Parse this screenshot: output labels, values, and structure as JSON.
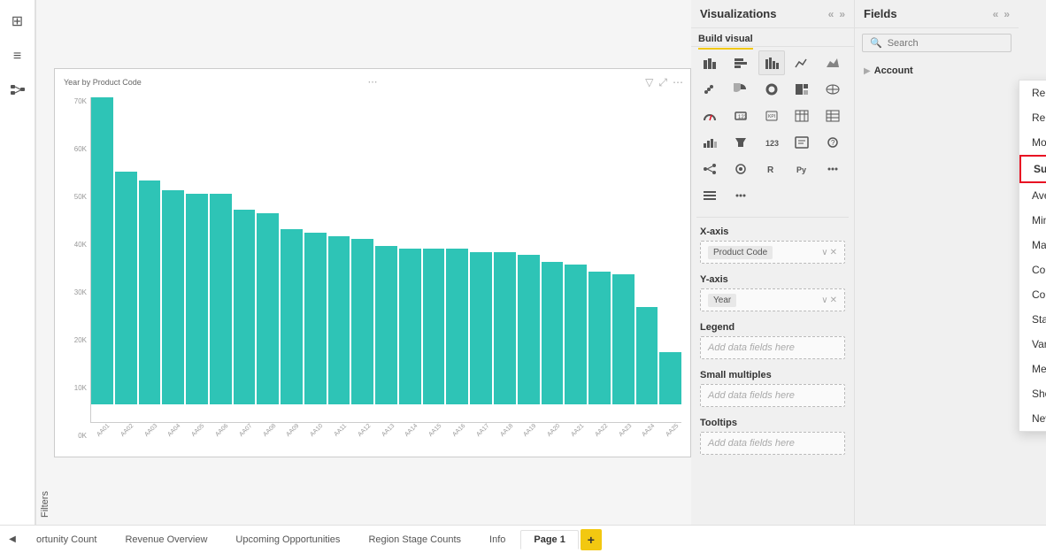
{
  "leftSidebar": {
    "icons": [
      "⊞",
      "≡",
      "📋"
    ]
  },
  "filters": {
    "label": "Filters"
  },
  "chart": {
    "title": "Year by Product Code",
    "yLabels": [
      "70K",
      "60K",
      "50K",
      "40K",
      "30K",
      "20K",
      "10K",
      "0K"
    ],
    "bars": [
      95,
      72,
      69,
      66,
      65,
      65,
      60,
      59,
      54,
      53,
      52,
      51,
      49,
      48,
      48,
      48,
      47,
      47,
      46,
      44,
      43,
      41,
      40,
      30,
      16
    ],
    "xLabels": [
      "AA01",
      "AA02",
      "AA03",
      "AA04",
      "AA05",
      "AA06",
      "AA07",
      "AA08",
      "AA09",
      "AA10",
      "AA11",
      "AA12",
      "AA13",
      "AA14",
      "AA15",
      "AA16",
      "AA17",
      "AA18",
      "AA19",
      "AA20",
      "AA21",
      "AA22",
      "AA23",
      "AA24",
      "AA25"
    ]
  },
  "visualizations": {
    "title": "Visualizations",
    "buildVisualTab": "Build visual",
    "fields": {
      "xAxis": {
        "label": "X-axis",
        "value": "Product Code"
      },
      "yAxis": {
        "label": "Y-axis",
        "value": "Year"
      },
      "legend": {
        "label": "Legend",
        "placeholder": "Add data fields here"
      },
      "smallMultiples": {
        "label": "Small multiples",
        "placeholder": "Add data fields here"
      },
      "tooltips": {
        "label": "Tooltips",
        "placeholder": "Add data fields here"
      }
    }
  },
  "fields": {
    "title": "Fields",
    "search": {
      "placeholder": "Search"
    },
    "groups": [
      {
        "label": "Account",
        "expanded": true
      }
    ]
  },
  "contextMenu": {
    "items": [
      {
        "label": "Remove field",
        "id": "remove-field",
        "active": false,
        "hasChevron": false
      },
      {
        "label": "Rename for this visual",
        "id": "rename",
        "active": false,
        "hasChevron": false
      },
      {
        "label": "Move to",
        "id": "move-to",
        "active": false,
        "hasChevron": true
      },
      {
        "label": "Sum",
        "id": "sum",
        "active": true,
        "hasChevron": false
      },
      {
        "label": "Average",
        "id": "average",
        "active": false,
        "hasChevron": false
      },
      {
        "label": "Minimum",
        "id": "minimum",
        "active": false,
        "hasChevron": false
      },
      {
        "label": "Maximum",
        "id": "maximum",
        "active": false,
        "hasChevron": false
      },
      {
        "label": "Count (Distinct)",
        "id": "count-distinct",
        "active": false,
        "hasChevron": false
      },
      {
        "label": "Count",
        "id": "count",
        "active": false,
        "hasChevron": false
      },
      {
        "label": "Standard deviation",
        "id": "std-dev",
        "active": false,
        "hasChevron": false
      },
      {
        "label": "Variance",
        "id": "variance",
        "active": false,
        "hasChevron": false
      },
      {
        "label": "Median",
        "id": "median",
        "active": false,
        "hasChevron": false
      },
      {
        "label": "Show value as",
        "id": "show-value-as",
        "active": false,
        "hasChevron": true
      },
      {
        "label": "New quick measure",
        "id": "new-quick-measure",
        "active": false,
        "hasChevron": false
      }
    ]
  },
  "bottomTabs": {
    "tabs": [
      {
        "label": "ortunity Count",
        "active": false
      },
      {
        "label": "Revenue Overview",
        "active": false
      },
      {
        "label": "Upcoming Opportunities",
        "active": false
      },
      {
        "label": "Region Stage Counts",
        "active": false
      },
      {
        "label": "Info",
        "active": false
      },
      {
        "label": "Page 1",
        "active": true
      }
    ],
    "addLabel": "+"
  }
}
